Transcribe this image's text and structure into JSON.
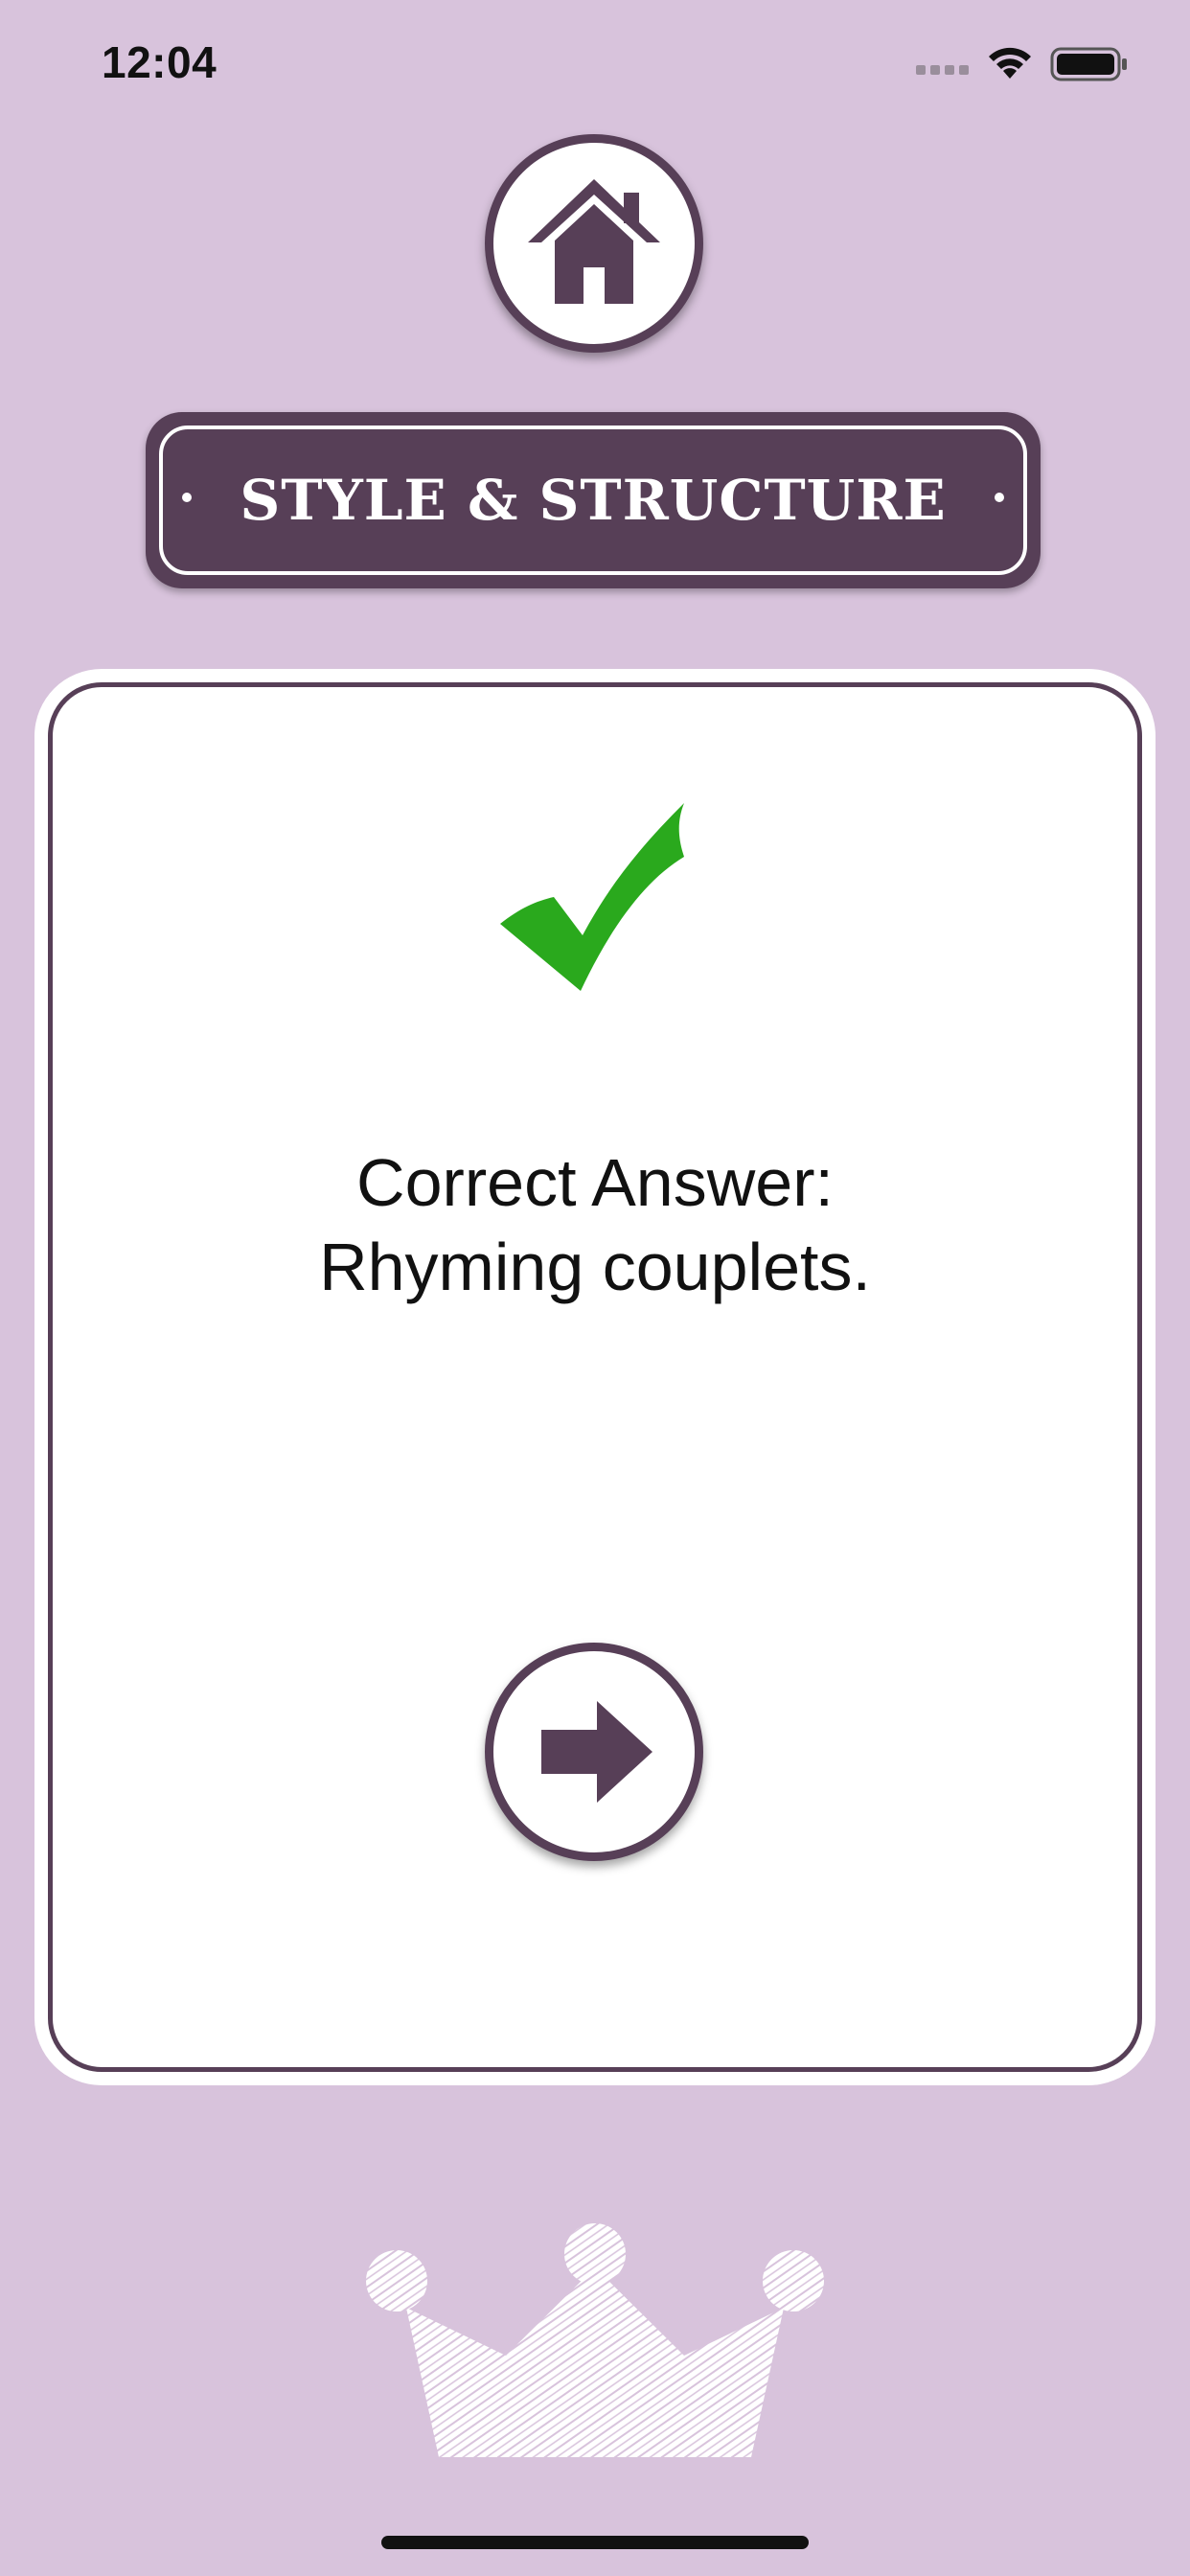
{
  "status_bar": {
    "time": "12:04"
  },
  "icons": {
    "home": "home-icon",
    "check": "checkmark-icon",
    "next": "arrow-right-icon",
    "crown": "crown-icon",
    "wifi": "wifi-icon",
    "battery": "battery-icon",
    "signal": "signal-icon"
  },
  "header": {
    "title": "STYLE & STRUCTURE"
  },
  "result": {
    "line1": "Correct Answer:",
    "line2": "Rhyming couplets."
  },
  "colors": {
    "background": "#d8c3dc",
    "accent": "#573f57",
    "correct": "#2aa91d"
  }
}
